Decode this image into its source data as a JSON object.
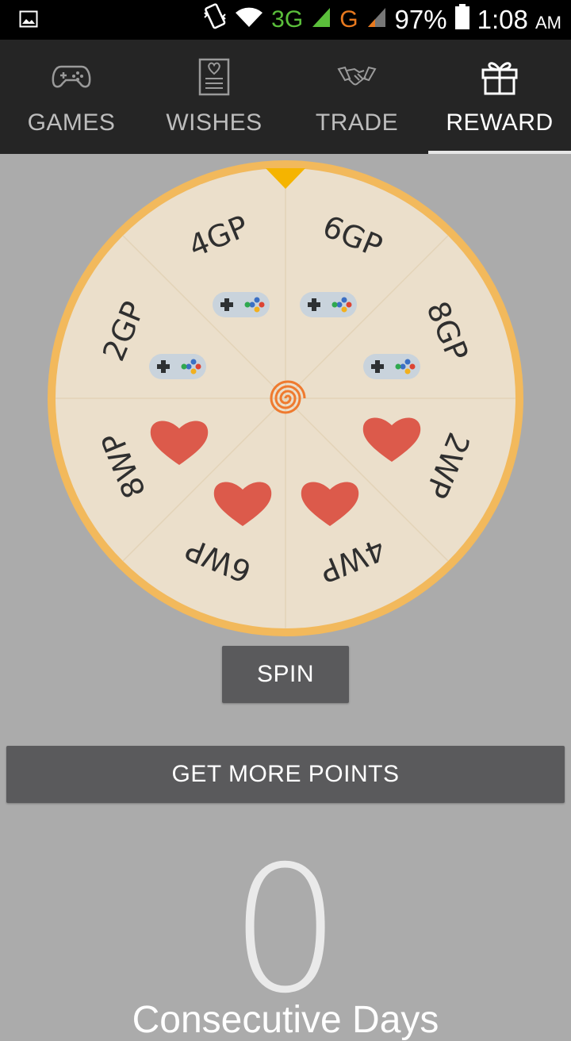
{
  "status_bar": {
    "network_3g": "3G",
    "network_g": "G",
    "battery": "97%",
    "time": "1:08",
    "ampm": "AM"
  },
  "tabs": [
    {
      "label": "GAMES",
      "icon": "gamepad-icon",
      "active": false
    },
    {
      "label": "WISHES",
      "icon": "wishlist-icon",
      "active": false
    },
    {
      "label": "TRADE",
      "icon": "handshake-icon",
      "active": false
    },
    {
      "label": "REWARD",
      "icon": "gift-icon",
      "active": true
    }
  ],
  "wheel": {
    "segments": [
      "6GP",
      "8GP",
      "2WP",
      "4WP",
      "6WP",
      "8WP",
      "2GP",
      "4GP"
    ],
    "colors": {
      "rim": "#f2b95c",
      "face": "#ebdfcb",
      "pointer": "#f5b400",
      "heart": "#dc5a4b"
    }
  },
  "buttons": {
    "spin": "SPIN",
    "get_more_points": "GET MORE POINTS"
  },
  "counter": {
    "value": "0",
    "caption": "Consecutive Days"
  }
}
